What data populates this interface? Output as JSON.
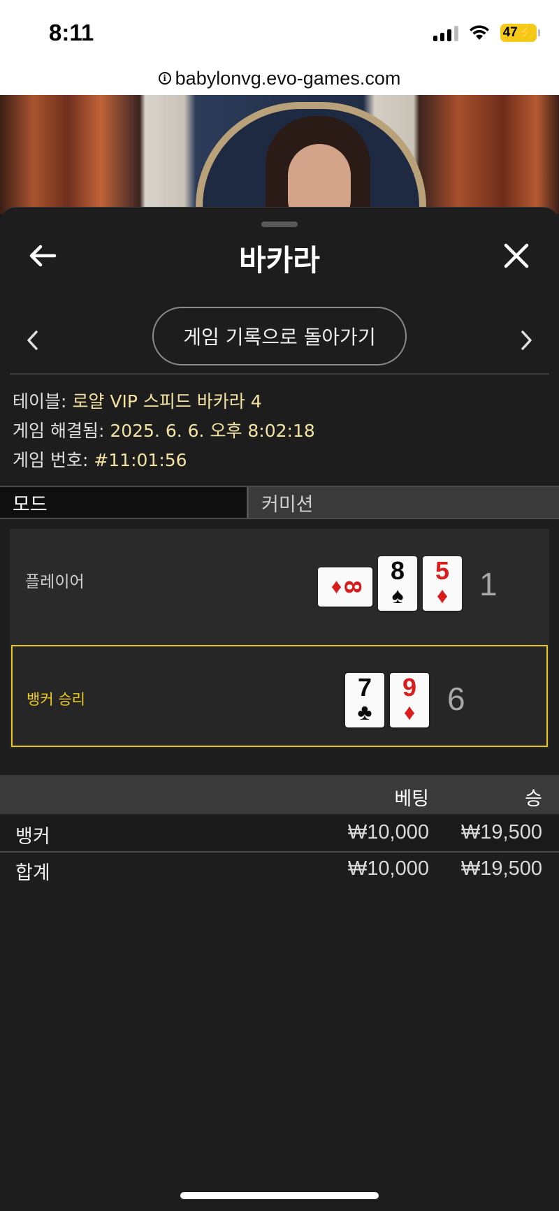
{
  "status_bar": {
    "time": "8:11",
    "battery": "47"
  },
  "browser": {
    "url": "babylonvg.evo-games.com"
  },
  "sheet": {
    "title": "바카라",
    "back_to_history_label": "게임 기록으로 돌아가기",
    "info": {
      "table_label": "테이블:",
      "table_value": "로얄 VIP 스피드 바카라 4",
      "resolved_label": "게임 해결됨:",
      "resolved_value": "2025. 6. 6. 오후 8:02:18",
      "game_number_label": "게임 번호:",
      "game_number_value": "#11:01:56"
    },
    "tabs": [
      {
        "label": "모드",
        "active": true
      },
      {
        "label": "커미션",
        "active": false
      }
    ],
    "player": {
      "label": "플레이어",
      "cards": [
        {
          "rank": "8",
          "suit": "♦",
          "color": "red",
          "orientation": "sideways"
        },
        {
          "rank": "8",
          "suit": "♠",
          "color": "black",
          "orientation": "upright"
        },
        {
          "rank": "5",
          "suit": "♦",
          "color": "red",
          "orientation": "upright"
        }
      ],
      "score": "1"
    },
    "banker": {
      "label": "뱅커 승리",
      "cards": [
        {
          "rank": "7",
          "suit": "♣",
          "color": "black",
          "orientation": "upright"
        },
        {
          "rank": "9",
          "suit": "♦",
          "color": "red",
          "orientation": "upright"
        }
      ],
      "score": "6",
      "highlight_color": "#e7c61b"
    },
    "bets": {
      "header": {
        "bet": "베팅",
        "win": "승"
      },
      "rows": [
        {
          "name": "뱅커",
          "bet": "₩10,000",
          "win": "₩19,500"
        }
      ],
      "total": {
        "name": "합계",
        "bet": "₩10,000",
        "win": "₩19,500"
      }
    }
  },
  "colors": {
    "accent_gold": "#e7c61b",
    "info_value": "#f3e3a2",
    "card_red": "#d91c1c"
  }
}
